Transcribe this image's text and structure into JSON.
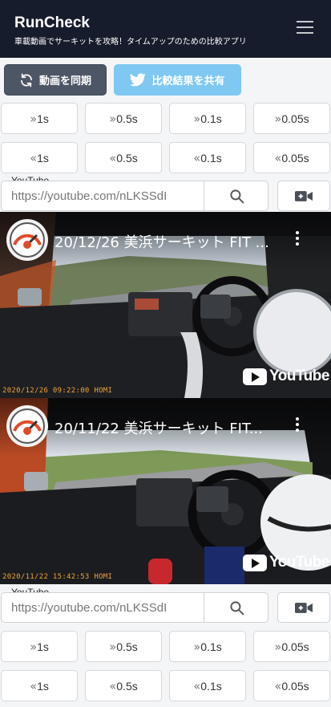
{
  "header": {
    "title": "RunCheck",
    "subtitle": "車載動画でサーキットを攻略！タイムアップのための比較アプリ"
  },
  "actions": {
    "sync_label": "動画を同期",
    "share_label": "比較結果を共有"
  },
  "forward_steps": [
    {
      "label": "1s"
    },
    {
      "label": "0.5s"
    },
    {
      "label": "0.1s"
    },
    {
      "label": "0.05s"
    }
  ],
  "backward_steps": [
    {
      "label": "1s"
    },
    {
      "label": "0.5s"
    },
    {
      "label": "0.1s"
    },
    {
      "label": "0.05s"
    }
  ],
  "players": [
    {
      "source_label": "YouTube",
      "url_value": "https://youtube.com/nLKSSdI",
      "video_title": "20/12/26 美浜サーキット FIT ...",
      "timestamp": "2020/12/26 09:22:00 HOMI",
      "logo_text": "YouTube"
    },
    {
      "source_label": "YouTube",
      "url_value": "https://youtube.com/nLKSSdI",
      "video_title": "20/11/22 美浜サーキット FIT...",
      "timestamp": "2020/11/22 15:42:53 HOMI",
      "logo_text": "YouTube"
    }
  ],
  "icons": {
    "menu": "hamburger-icon",
    "sync": "refresh-icon",
    "share": "twitter-icon",
    "forward": "chevron-double-right-icon",
    "backward": "chevron-double-left-icon",
    "search": "search-icon",
    "camera": "video-camera-icon",
    "more": "kebab-icon"
  },
  "colors": {
    "header_bg": "#171c2c",
    "sync_button": "#4d5665",
    "share_button": "#7ec8f2",
    "timestamp": "#f2a23a"
  }
}
